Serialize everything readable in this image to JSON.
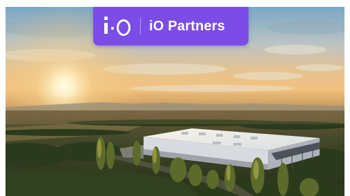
{
  "brand": {
    "logo_icon": "io-logo-mark",
    "name": "iO Partners",
    "badge_color": "#7b4de6"
  },
  "photo": {
    "scene": "aerial-sunset-warehouse",
    "sky_color": "#7aa6c4",
    "sun_color": "#fff2c8",
    "roof_color": "#eef0f2"
  }
}
